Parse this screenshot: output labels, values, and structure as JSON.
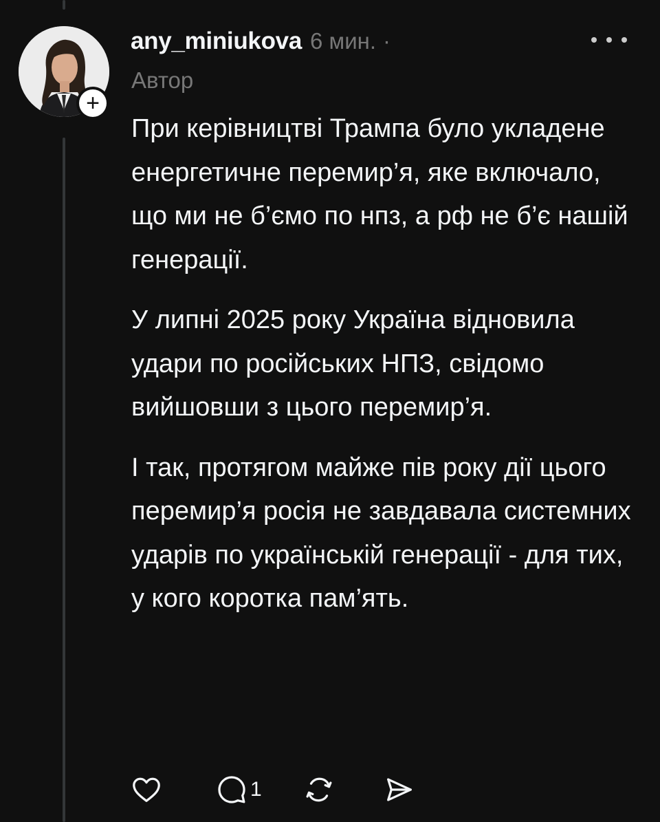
{
  "post": {
    "username": "any_miniukova",
    "time": "6 мин.",
    "separator": "·",
    "author_tag": "Автор",
    "follow_symbol": "+",
    "paragraphs": [
      "При керівництві Трампа було укладене енергетичне перемир’я, яке включало, що ми не б’ємо по нпз, а рф не б’є нашій генерації.",
      "У липні 2025 року Україна відновила удари по російських НПЗ, свідомо вийшовши з цього перемир’я.",
      "І так, протягом майже пів року дії цього перемир’я росія не завдавала системних ударів по українській генерації -  для тих, у кого коротка пам’ять."
    ]
  },
  "actions": {
    "like_icon": "heart-icon",
    "reply_icon": "comment-icon",
    "reply_count": "1",
    "repost_icon": "repost-icon",
    "share_icon": "send-icon"
  },
  "colors": {
    "background": "#101010",
    "text": "#f3f5f7",
    "muted": "#777777",
    "thread_line": "#333638"
  }
}
